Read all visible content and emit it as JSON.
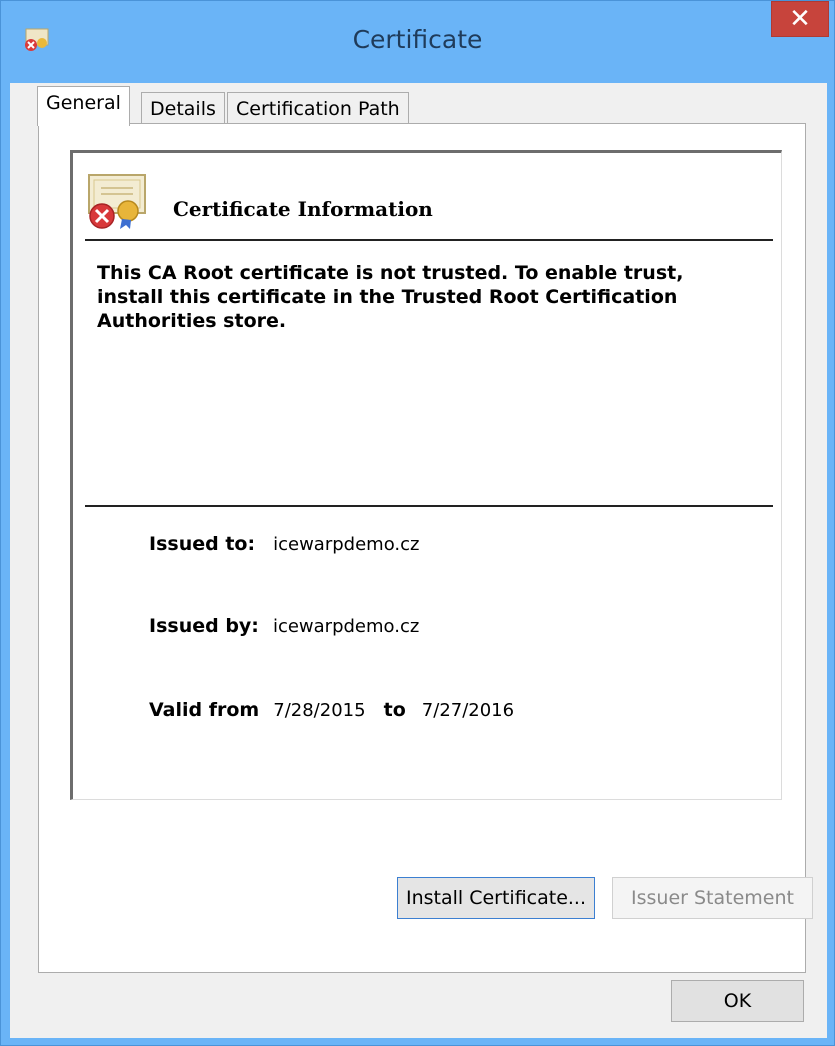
{
  "window": {
    "title": "Certificate",
    "close_symbol": "✕",
    "icon": "certificate-error-icon"
  },
  "tabs": [
    {
      "label": "General",
      "selected": true
    },
    {
      "label": "Details",
      "selected": false
    },
    {
      "label": "Certification Path",
      "selected": false
    }
  ],
  "general": {
    "heading": "Certificate Information",
    "heading_icon": "certificate-error-icon",
    "warning": "This CA Root certificate is not trusted. To enable trust, install this certificate in the Trusted Root Certification Authorities store.",
    "issued_to_label": "Issued to:",
    "issued_to_value": "icewarpdemo.cz",
    "issued_by_label": "Issued by:",
    "issued_by_value": "icewarpdemo.cz",
    "valid_from_label": "Valid from",
    "valid_from_value": "7/28/2015",
    "valid_to_label": "to",
    "valid_to_value": "7/27/2016"
  },
  "buttons": {
    "install_label": "Install Certificate...",
    "issuer_label": "Issuer Statement",
    "ok_label": "OK"
  },
  "colors": {
    "titlebar": "#6ab4f7",
    "close": "#c7443c",
    "focus_border": "#3c7fd1"
  }
}
